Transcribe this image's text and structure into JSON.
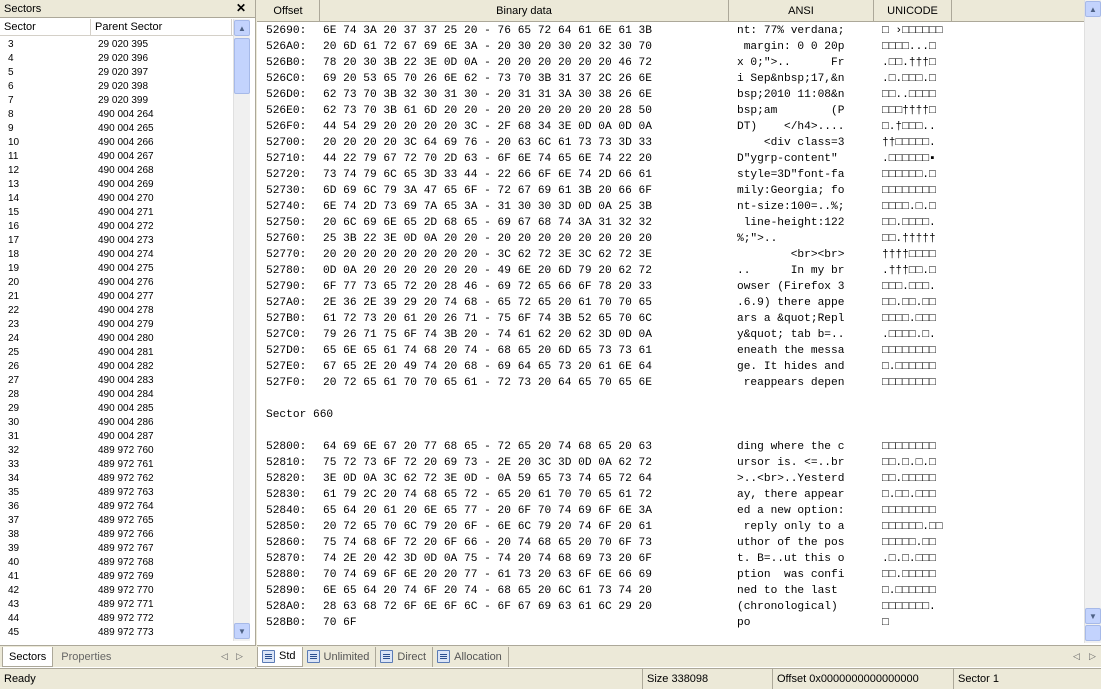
{
  "left_pane": {
    "title": "Sectors",
    "close_glyph": "✕",
    "columns": [
      "Sector",
      "Parent Sector"
    ],
    "rows": [
      [
        "3",
        "29 020 395"
      ],
      [
        "4",
        "29 020 396"
      ],
      [
        "5",
        "29 020 397"
      ],
      [
        "6",
        "29 020 398"
      ],
      [
        "7",
        "29 020 399"
      ],
      [
        "8",
        "490 004 264"
      ],
      [
        "9",
        "490 004 265"
      ],
      [
        "10",
        "490 004 266"
      ],
      [
        "11",
        "490 004 267"
      ],
      [
        "12",
        "490 004 268"
      ],
      [
        "13",
        "490 004 269"
      ],
      [
        "14",
        "490 004 270"
      ],
      [
        "15",
        "490 004 271"
      ],
      [
        "16",
        "490 004 272"
      ],
      [
        "17",
        "490 004 273"
      ],
      [
        "18",
        "490 004 274"
      ],
      [
        "19",
        "490 004 275"
      ],
      [
        "20",
        "490 004 276"
      ],
      [
        "21",
        "490 004 277"
      ],
      [
        "22",
        "490 004 278"
      ],
      [
        "23",
        "490 004 279"
      ],
      [
        "24",
        "490 004 280"
      ],
      [
        "25",
        "490 004 281"
      ],
      [
        "26",
        "490 004 282"
      ],
      [
        "27",
        "490 004 283"
      ],
      [
        "28",
        "490 004 284"
      ],
      [
        "29",
        "490 004 285"
      ],
      [
        "30",
        "490 004 286"
      ],
      [
        "31",
        "490 004 287"
      ],
      [
        "32",
        "489 972 760"
      ],
      [
        "33",
        "489 972 761"
      ],
      [
        "34",
        "489 972 762"
      ],
      [
        "35",
        "489 972 763"
      ],
      [
        "36",
        "489 972 764"
      ],
      [
        "37",
        "489 972 765"
      ],
      [
        "38",
        "489 972 766"
      ],
      [
        "39",
        "489 972 767"
      ],
      [
        "40",
        "489 972 768"
      ],
      [
        "41",
        "489 972 769"
      ],
      [
        "42",
        "489 972 770"
      ],
      [
        "43",
        "489 972 771"
      ],
      [
        "44",
        "489 972 772"
      ],
      [
        "45",
        "489 972 773"
      ]
    ],
    "tabs": [
      "Sectors",
      "Properties"
    ]
  },
  "hex_view": {
    "columns": [
      "Offset",
      "Binary data",
      "ANSI",
      "UNICODE"
    ],
    "block1": [
      [
        "52690:",
        "6E 74 3A 20 37 37 25 20 - 76 65 72 64 61 6E 61 3B",
        "nt: 77% verdana;",
        "□ ›□□□□□□"
      ],
      [
        "526A0:",
        "20 6D 61 72 67 69 6E 3A - 20 30 20 30 20 32 30 70",
        " margin: 0 0 20p",
        "□□□□...□"
      ],
      [
        "526B0:",
        "78 20 30 3B 22 3E 0D 0A - 20 20 20 20 20 20 46 72",
        "x 0;\">..      Fr",
        ".□□.†††□"
      ],
      [
        "526C0:",
        "69 20 53 65 70 26 6E 62 - 73 70 3B 31 37 2C 26 6E",
        "i Sep&nbsp;17,&n",
        ".□.□□□.□"
      ],
      [
        "526D0:",
        "62 73 70 3B 32 30 31 30 - 20 31 31 3A 30 38 26 6E",
        "bsp;2010 11:08&n",
        "□□..□□□□"
      ],
      [
        "526E0:",
        "62 73 70 3B 61 6D 20 20 - 20 20 20 20 20 20 28 50",
        "bsp;am        (P",
        "□□□††††□"
      ],
      [
        "526F0:",
        "44 54 29 20 20 20 20 3C - 2F 68 34 3E 0D 0A 0D 0A",
        "DT)    </h4>....",
        "□.†□□□.."
      ],
      [
        "52700:",
        "20 20 20 20 3C 64 69 76 - 20 63 6C 61 73 73 3D 33",
        "    <div class=3",
        "††□□□□□."
      ],
      [
        "52710:",
        "44 22 79 67 72 70 2D 63 - 6F 6E 74 65 6E 74 22 20",
        "D\"ygrp-content\" ",
        ".□□□□□□▪"
      ],
      [
        "52720:",
        "73 74 79 6C 65 3D 33 44 - 22 66 6F 6E 74 2D 66 61",
        "style=3D\"font-fa",
        "□□□□□□.□"
      ],
      [
        "52730:",
        "6D 69 6C 79 3A 47 65 6F - 72 67 69 61 3B 20 66 6F",
        "mily:Georgia; fo",
        "□□□□□□□□"
      ],
      [
        "52740:",
        "6E 74 2D 73 69 7A 65 3A - 31 30 30 3D 0D 0A 25 3B",
        "nt-size:100=..%;",
        "□□□□.□.□"
      ],
      [
        "52750:",
        "20 6C 69 6E 65 2D 68 65 - 69 67 68 74 3A 31 32 32",
        " line-height:122",
        "□□.□□□□."
      ],
      [
        "52760:",
        "25 3B 22 3E 0D 0A 20 20 - 20 20 20 20 20 20 20 20",
        "%;\">..          ",
        "□□.†††††"
      ],
      [
        "52770:",
        "20 20 20 20 20 20 20 20 - 3C 62 72 3E 3C 62 72 3E",
        "        <br><br>",
        "††††□□□□"
      ],
      [
        "52780:",
        "0D 0A 20 20 20 20 20 20 - 49 6E 20 6D 79 20 62 72",
        "..      In my br",
        ".†††□□.□"
      ],
      [
        "52790:",
        "6F 77 73 65 72 20 28 46 - 69 72 65 66 6F 78 20 33",
        "owser (Firefox 3",
        "□□□.□□□."
      ],
      [
        "527A0:",
        "2E 36 2E 39 29 20 74 68 - 65 72 65 20 61 70 70 65",
        ".6.9) there appe",
        "□□.□□.□□"
      ],
      [
        "527B0:",
        "61 72 73 20 61 20 26 71 - 75 6F 74 3B 52 65 70 6C",
        "ars a &quot;Repl",
        "□□□□.□□□"
      ],
      [
        "527C0:",
        "79 26 71 75 6F 74 3B 20 - 74 61 62 20 62 3D 0D 0A",
        "y&quot; tab b=..",
        ".□□□□.□."
      ],
      [
        "527D0:",
        "65 6E 65 61 74 68 20 74 - 68 65 20 6D 65 73 73 61",
        "eneath the messa",
        "□□□□□□□□"
      ],
      [
        "527E0:",
        "67 65 2E 20 49 74 20 68 - 69 64 65 73 20 61 6E 64",
        "ge. It hides and",
        "□.□□□□□□"
      ],
      [
        "527F0:",
        "20 72 65 61 70 70 65 61 - 72 73 20 64 65 70 65 6E",
        " reappears depen",
        "□□□□□□□□"
      ]
    ],
    "sector_label": "Sector 660",
    "block2": [
      [
        "52800:",
        "64 69 6E 67 20 77 68 65 - 72 65 20 74 68 65 20 63",
        "ding where the c",
        "□□□□□□□□"
      ],
      [
        "52810:",
        "75 72 73 6F 72 20 69 73 - 2E 20 3C 3D 0D 0A 62 72",
        "ursor is. <=..br",
        "□□.□.□.□"
      ],
      [
        "52820:",
        "3E 0D 0A 3C 62 72 3E 0D - 0A 59 65 73 74 65 72 64",
        ">..<br>..Yesterd",
        "□□.□□□□□"
      ],
      [
        "52830:",
        "61 79 2C 20 74 68 65 72 - 65 20 61 70 70 65 61 72",
        "ay, there appear",
        "□.□□.□□□"
      ],
      [
        "52840:",
        "65 64 20 61 20 6E 65 77 - 20 6F 70 74 69 6F 6E 3A",
        "ed a new option:",
        "□□□□□□□□"
      ],
      [
        "52850:",
        "20 72 65 70 6C 79 20 6F - 6E 6C 79 20 74 6F 20 61",
        " reply only to a",
        "□□□□□□.□□"
      ],
      [
        "52860:",
        "75 74 68 6F 72 20 6F 66 - 20 74 68 65 20 70 6F 73",
        "uthor of the pos",
        "□□□□□.□□"
      ],
      [
        "52870:",
        "74 2E 20 42 3D 0D 0A 75 - 74 20 74 68 69 73 20 6F",
        "t. B=..ut this o",
        ".□.□.□□□"
      ],
      [
        "52880:",
        "70 74 69 6F 6E 20 20 77 - 61 73 20 63 6F 6E 66 69",
        "ption  was confi",
        "□□.□□□□□"
      ],
      [
        "52890:",
        "6E 65 64 20 74 6F 20 74 - 68 65 20 6C 61 73 74 20",
        "ned to the last ",
        "□.□□□□□□"
      ],
      [
        "528A0:",
        "28 63 68 72 6F 6E 6F 6C - 6F 67 69 63 61 6C 29 20",
        "(chronological) ",
        "□□□□□□□."
      ],
      [
        "528B0:",
        "70 6F",
        "po",
        "□"
      ]
    ],
    "tabs": [
      "Std",
      "Unlimited",
      "Direct",
      "Allocation"
    ]
  },
  "status_bar": {
    "state": "Ready",
    "size": "Size 338098",
    "offset": "Offset 0x0000000000000000",
    "sector": "Sector 1"
  }
}
